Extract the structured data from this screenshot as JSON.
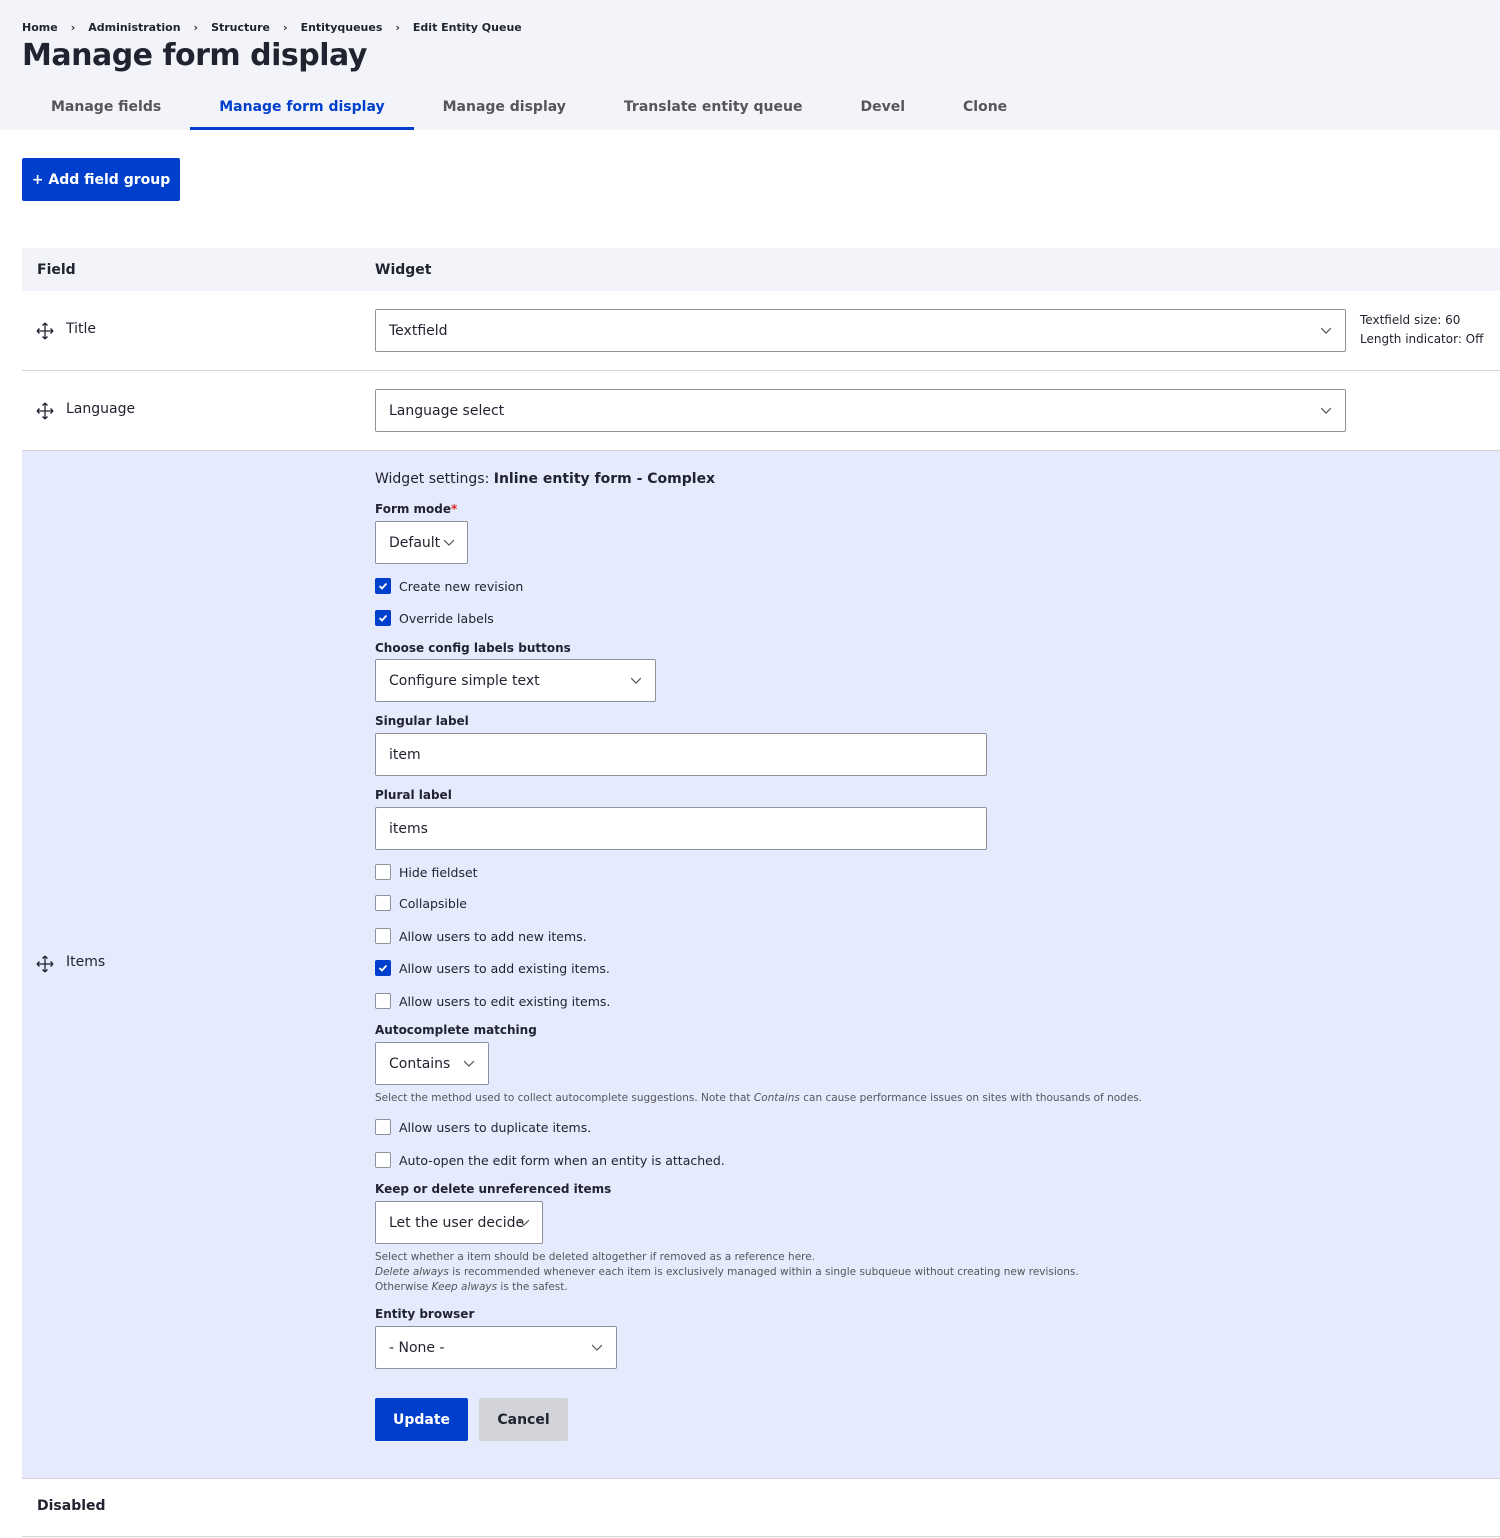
{
  "breadcrumb": [
    "Home",
    "Administration",
    "Structure",
    "Entityqueues",
    "Edit Entity Queue"
  ],
  "page_title": "Manage form display",
  "tabs": [
    {
      "label": "Manage fields",
      "active": false
    },
    {
      "label": "Manage form display",
      "active": true
    },
    {
      "label": "Manage display",
      "active": false
    },
    {
      "label": "Translate entity queue",
      "active": false
    },
    {
      "label": "Devel",
      "active": false
    },
    {
      "label": "Clone",
      "active": false
    }
  ],
  "add_field_group_label": "+ Add field group",
  "table": {
    "headers": {
      "field": "Field",
      "widget": "Widget"
    },
    "rows": {
      "title": {
        "name": "Title",
        "widget": "Textfield",
        "summary": [
          "Textfield size: 60",
          "Length indicator: Off"
        ]
      },
      "language": {
        "name": "Language",
        "widget": "Language select"
      },
      "items": {
        "name": "Items"
      }
    },
    "disabled_label": "Disabled"
  },
  "widget_settings": {
    "prefix": "Widget settings: ",
    "name": "Inline entity form - Complex",
    "form_mode": {
      "label": "Form mode",
      "required_mark": "*",
      "value": "Default"
    },
    "create_new_revision": {
      "label": "Create new revision",
      "checked": true
    },
    "override_labels": {
      "label": "Override labels",
      "checked": true
    },
    "config_labels": {
      "label": "Choose config labels buttons",
      "value": "Configure simple text"
    },
    "singular_label": {
      "label": "Singular label",
      "value": "item"
    },
    "plural_label": {
      "label": "Plural label",
      "value": "items"
    },
    "hide_fieldset": {
      "label": "Hide fieldset",
      "checked": false
    },
    "collapsible": {
      "label": "Collapsible",
      "checked": false
    },
    "allow_new": {
      "label": "Allow users to add new items.",
      "checked": false
    },
    "allow_existing": {
      "label": "Allow users to add existing items.",
      "checked": true
    },
    "allow_edit": {
      "label": "Allow users to edit existing items.",
      "checked": false
    },
    "autocomplete": {
      "label": "Autocomplete matching",
      "value": "Contains",
      "desc_before": "Select the method used to collect autocomplete suggestions. Note that ",
      "desc_em": "Contains",
      "desc_after": " can cause performance issues on sites with thousands of nodes."
    },
    "allow_duplicate": {
      "label": "Allow users to duplicate items.",
      "checked": false
    },
    "auto_open": {
      "label": "Auto-open the edit form when an entity is attached.",
      "checked": false
    },
    "keep_delete": {
      "label": "Keep or delete unreferenced items",
      "value": "Let the user decide",
      "desc_line1": "Select whether a item should be deleted altogether if removed as a reference here.",
      "desc_line2_em": "Delete always",
      "desc_line2": " is recommended whenever each item is exclusively managed within a single subqueue without creating new revisions.",
      "desc_line3_before": "Otherwise ",
      "desc_line3_em": "Keep always",
      "desc_line3_after": " is the safest."
    },
    "entity_browser": {
      "label": "Entity browser",
      "value": "- None -"
    },
    "update_label": "Update",
    "cancel_label": "Cancel"
  },
  "colors": {
    "accent": "#003ecc",
    "edit_row_bg": "#e5ebfc",
    "header_bg": "#f3f4f9"
  }
}
